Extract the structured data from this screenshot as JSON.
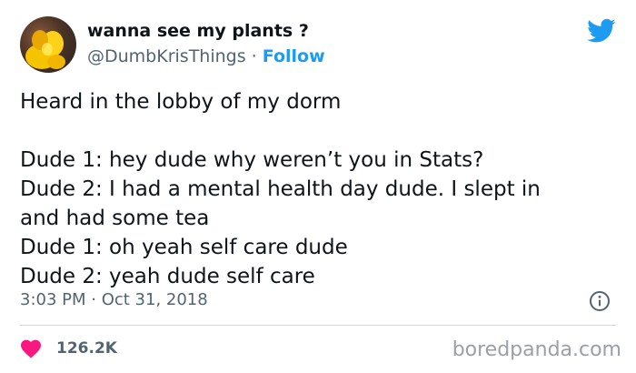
{
  "author": {
    "display_name": "wanna see my plants ?",
    "handle": "@DumbKrisThings",
    "separator": " · ",
    "follow_label": "Follow",
    "avatar_icon": "profile-avatar"
  },
  "platform_icon": "twitter-bird-icon",
  "tweet": {
    "lines": [
      "Heard in the lobby of my dorm",
      "",
      "Dude 1: hey dude why weren’t you in Stats?",
      "Dude 2: I had a mental health day dude. I slept in",
      "and had some tea",
      "Dude 1: oh yeah self care dude",
      "Dude 2: yeah dude self care"
    ],
    "time": "3:03 PM",
    "meta_separator": " · ",
    "date": "Oct 31, 2018"
  },
  "engagement": {
    "likes": "126.2K"
  },
  "watermark": "boredpanda.com",
  "colors": {
    "accent": "#1d9bf0",
    "like": "#f91880",
    "text": "#0f1419",
    "muted": "#536471"
  }
}
